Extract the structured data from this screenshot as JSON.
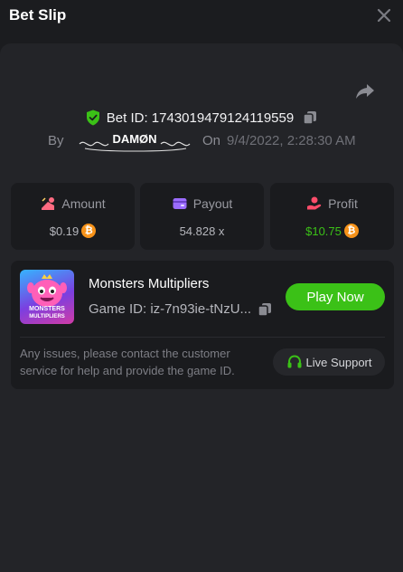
{
  "header": {
    "title": "Bet Slip"
  },
  "bet": {
    "id_text": "Bet ID: 1743019479124119559",
    "by_label": "By",
    "username": "DAMØN",
    "on_label": "On",
    "date": "9/4/2022, 2:28:30 AM"
  },
  "stats": [
    {
      "label": "Amount",
      "value": "$0.19",
      "value_color": "#b5b6bc",
      "icon": "money-bag-icon",
      "coin": true
    },
    {
      "label": "Payout",
      "value": "54.828 x",
      "value_color": "#b5b6bc",
      "icon": "wallet-icon",
      "coin": false
    },
    {
      "label": "Profit",
      "value": "$10.75",
      "value_color": "#3bc117",
      "icon": "hand-coin-icon",
      "coin": true
    }
  ],
  "game": {
    "name": "Monsters Multipliers",
    "id_text": "Game ID: iz-7n93ie-tNzU...",
    "thumb_line1": "MONSTERS",
    "thumb_line2": "MULTIPLIERS",
    "play_label": "Play Now"
  },
  "support": {
    "issues_text": "Any issues, please contact the customer service for help and provide the game ID.",
    "button_label": "Live Support"
  },
  "colors": {
    "accent_green": "#3bc117",
    "bitcoin_orange": "#f7931a",
    "amount_icon": "#ff6b81",
    "payout_icon": "#9b6cff",
    "profit_icon": "#ff4d6a"
  }
}
